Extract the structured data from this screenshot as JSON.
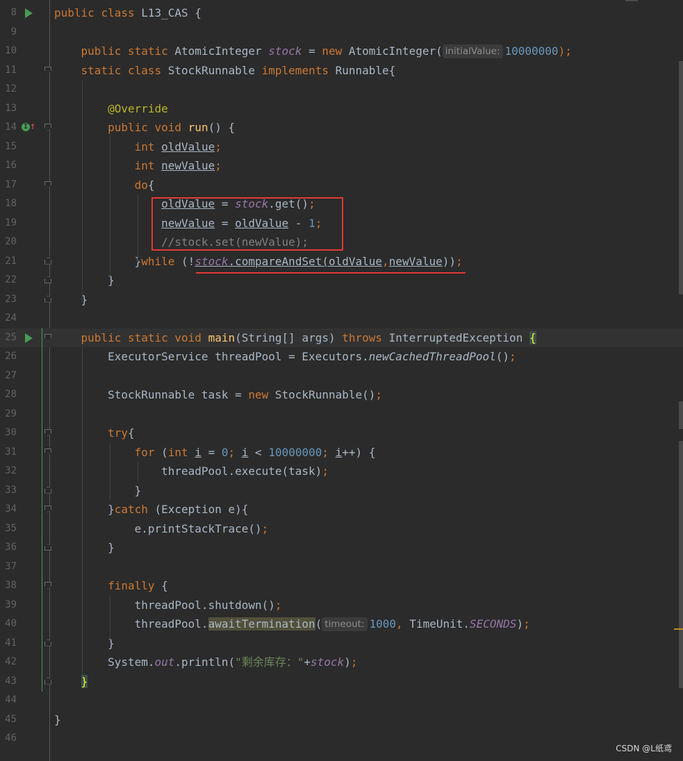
{
  "lines": [
    {
      "n": "8",
      "run": true,
      "impl": false,
      "fold": "",
      "current": false
    },
    {
      "n": "9",
      "run": false,
      "impl": false,
      "fold": "",
      "current": false
    },
    {
      "n": "10",
      "run": false,
      "impl": false,
      "fold": "",
      "current": false
    },
    {
      "n": "11",
      "run": false,
      "impl": false,
      "fold": "start",
      "current": false
    },
    {
      "n": "12",
      "run": false,
      "impl": false,
      "fold": "",
      "current": false
    },
    {
      "n": "13",
      "run": false,
      "impl": false,
      "fold": "",
      "current": false
    },
    {
      "n": "14",
      "run": false,
      "impl": true,
      "fold": "start",
      "current": false
    },
    {
      "n": "15",
      "run": false,
      "impl": false,
      "fold": "",
      "current": false
    },
    {
      "n": "16",
      "run": false,
      "impl": false,
      "fold": "",
      "current": false
    },
    {
      "n": "17",
      "run": false,
      "impl": false,
      "fold": "start",
      "current": false
    },
    {
      "n": "18",
      "run": false,
      "impl": false,
      "fold": "",
      "current": false
    },
    {
      "n": "19",
      "run": false,
      "impl": false,
      "fold": "",
      "current": false
    },
    {
      "n": "20",
      "run": false,
      "impl": false,
      "fold": "",
      "current": false
    },
    {
      "n": "21",
      "run": false,
      "impl": false,
      "fold": "end",
      "current": false
    },
    {
      "n": "22",
      "run": false,
      "impl": false,
      "fold": "end",
      "current": false
    },
    {
      "n": "23",
      "run": false,
      "impl": false,
      "fold": "end",
      "current": false
    },
    {
      "n": "24",
      "run": false,
      "impl": false,
      "fold": "",
      "current": false
    },
    {
      "n": "25",
      "run": true,
      "impl": false,
      "fold": "start",
      "current": true
    },
    {
      "n": "26",
      "run": false,
      "impl": false,
      "fold": "",
      "current": false
    },
    {
      "n": "27",
      "run": false,
      "impl": false,
      "fold": "",
      "current": false
    },
    {
      "n": "28",
      "run": false,
      "impl": false,
      "fold": "",
      "current": false
    },
    {
      "n": "29",
      "run": false,
      "impl": false,
      "fold": "",
      "current": false
    },
    {
      "n": "30",
      "run": false,
      "impl": false,
      "fold": "start",
      "current": false
    },
    {
      "n": "31",
      "run": false,
      "impl": false,
      "fold": "start",
      "current": false
    },
    {
      "n": "32",
      "run": false,
      "impl": false,
      "fold": "",
      "current": false
    },
    {
      "n": "33",
      "run": false,
      "impl": false,
      "fold": "end",
      "current": false
    },
    {
      "n": "34",
      "run": false,
      "impl": false,
      "fold": "start",
      "current": false
    },
    {
      "n": "35",
      "run": false,
      "impl": false,
      "fold": "",
      "current": false
    },
    {
      "n": "36",
      "run": false,
      "impl": false,
      "fold": "end",
      "current": false
    },
    {
      "n": "37",
      "run": false,
      "impl": false,
      "fold": "",
      "current": false
    },
    {
      "n": "38",
      "run": false,
      "impl": false,
      "fold": "start",
      "current": false
    },
    {
      "n": "39",
      "run": false,
      "impl": false,
      "fold": "",
      "current": false
    },
    {
      "n": "40",
      "run": false,
      "impl": false,
      "fold": "",
      "current": false
    },
    {
      "n": "41",
      "run": false,
      "impl": false,
      "fold": "end",
      "current": false
    },
    {
      "n": "42",
      "run": false,
      "impl": false,
      "fold": "",
      "current": false
    },
    {
      "n": "43",
      "run": false,
      "impl": false,
      "fold": "end",
      "current": false
    },
    {
      "n": "44",
      "run": false,
      "impl": false,
      "fold": "",
      "current": false
    },
    {
      "n": "45",
      "run": false,
      "impl": false,
      "fold": "",
      "current": false
    },
    {
      "n": "46",
      "run": false,
      "impl": false,
      "fold": "",
      "current": false
    }
  ],
  "code": {
    "l8": {
      "public": "public",
      "class": "class",
      "name": " L13_CAS {"
    },
    "l10": {
      "public": "public",
      "static": "static",
      "type": " AtomicInteger ",
      "field": "stock",
      "eq": " = ",
      "new": "new",
      "ctor": " AtomicInteger(",
      "hint": "initialValue:",
      "value": "10000000",
      "end": ");"
    },
    "l11": {
      "static": "static",
      "class": "class",
      "name": " StockRunnable ",
      "implements": "implements",
      "iface": " Runnable{"
    },
    "l13": {
      "annotation": "@Override"
    },
    "l14": {
      "public": "public",
      "void": "void",
      "method": "run",
      "rest": "() {"
    },
    "l15": {
      "int": "int",
      "var": "oldValue",
      "semi": ";"
    },
    "l16": {
      "int": "int",
      "var": "newValue",
      "semi": ";"
    },
    "l17": {
      "do": "do",
      "brace": "{"
    },
    "l18": {
      "var": "oldValue",
      "eq": " = ",
      "field": "stock",
      "call": ".get()",
      "semi": ";"
    },
    "l19": {
      "var": "newValue",
      "eq": " = ",
      "var2": "oldValue",
      "minus": " - ",
      "num": "1",
      "semi": ";"
    },
    "l20": {
      "comment": "//stock.set(newValue);"
    },
    "l21": {
      "brace": "}",
      "while": "while",
      "open": " (!",
      "field": "stock",
      "call": ".compareAndSet(",
      "a1": "oldValue",
      "comma": ",",
      "a2": "newValue",
      "close": "))",
      "semi": ";"
    },
    "l22": {
      "text": "}"
    },
    "l23": {
      "text": "}"
    },
    "l25": {
      "public": "public",
      "static": "static",
      "void": "void",
      "method": "main",
      "params": "(String[] args) ",
      "throws": "throws",
      "exc": " InterruptedException ",
      "brace": "{"
    },
    "l26": {
      "pre": "ExecutorService threadPool = Executors.",
      "static_call": "newCachedThreadPool",
      "post": "()",
      "semi": ";"
    },
    "l28": {
      "pre": "StockRunnable task = ",
      "new": "new",
      "post": " StockRunnable()",
      "semi": ";"
    },
    "l30": {
      "try": "try",
      "brace": "{"
    },
    "l31": {
      "for": "for",
      "open": " (",
      "int": "int",
      "sp": " ",
      "i1": "i",
      "eq": " = ",
      "zero": "0",
      "semi1": "; ",
      "i2": "i",
      "lt": " < ",
      "max": "10000000",
      "semi2": "; ",
      "i3": "i",
      "inc": "++) {"
    },
    "l32": {
      "text": "threadPool.execute(task)",
      "semi": ";"
    },
    "l33": {
      "text": "}"
    },
    "l34": {
      "brace": "}",
      "catch": "catch",
      "rest": " (Exception e){"
    },
    "l35": {
      "text": "e.printStackTrace()",
      "semi": ";"
    },
    "l36": {
      "text": "}"
    },
    "l38": {
      "finally": "finally",
      "brace": " {"
    },
    "l39": {
      "text": "threadPool.shutdown()",
      "semi": ";"
    },
    "l40": {
      "pre": "threadPool.",
      "method": "awaitTermination",
      "open": "(",
      "hint": "timeout:",
      "num": "1000",
      "comma": ",",
      "post": " TimeUnit.",
      "const": "SECONDS",
      "close": ")",
      "semi": ";"
    },
    "l41": {
      "text": "}"
    },
    "l42": {
      "pre": "System.",
      "out": "out",
      "call": ".println(",
      "str": "\"剩余库存：\"",
      "plus": "+",
      "field": "stock",
      "close": ")",
      "semi": ";"
    },
    "l43": {
      "brace": "}"
    },
    "l45": {
      "text": "}"
    }
  },
  "watermark": "CSDN @L纸鸢",
  "colors": {
    "background": "#2b2b2b",
    "keyword": "#cc7832",
    "field": "#9876aa",
    "method": "#ffc66d",
    "number": "#6897bb",
    "string": "#6a8759",
    "annotation": "#bbb529",
    "comment": "#808080",
    "highlight_box": "#e53935"
  }
}
